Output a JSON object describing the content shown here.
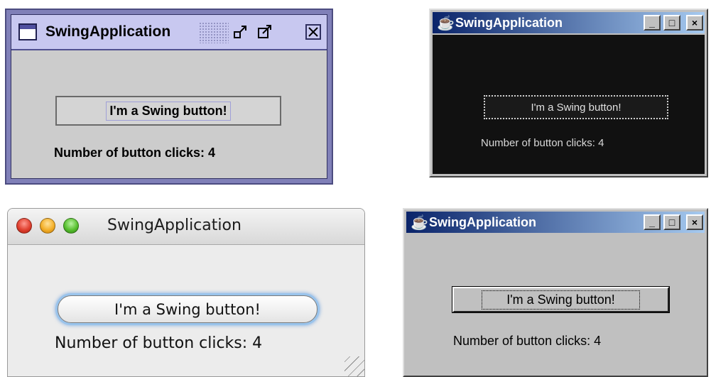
{
  "windows": [
    {
      "look": "CDE/Motif",
      "title": "SwingApplication",
      "button_label": "I'm a Swing button!",
      "click_label": "Number of button clicks: 4",
      "controls": {
        "minimize": "minimize-icon",
        "maximize": "maximize-icon",
        "close": "close-icon"
      }
    },
    {
      "look": "Windows classic (dark)",
      "title": "SwingApplication",
      "button_label": "I'm a Swing button!",
      "click_label": "Number of button clicks: 4",
      "controls": {
        "minimize": "_",
        "maximize": "□",
        "close": "×"
      }
    },
    {
      "look": "Mac Aqua",
      "title": "SwingApplication",
      "button_label": "I'm a Swing button!",
      "click_label": "Number of button clicks: 4"
    },
    {
      "look": "Windows classic",
      "title": "SwingApplication",
      "button_label": "I'm a Swing button!",
      "click_label": "Number of button clicks: 4",
      "controls": {
        "minimize": "_",
        "maximize": "□",
        "close": "×"
      }
    }
  ],
  "colors": {
    "cde_frame": "#8080b8",
    "cde_title": "#c8c8f0",
    "win_title_start": "#0a246a",
    "win_title_end": "#a6caf0",
    "dark_content": "#111111",
    "aqua_focus": "#9ac4ec"
  }
}
